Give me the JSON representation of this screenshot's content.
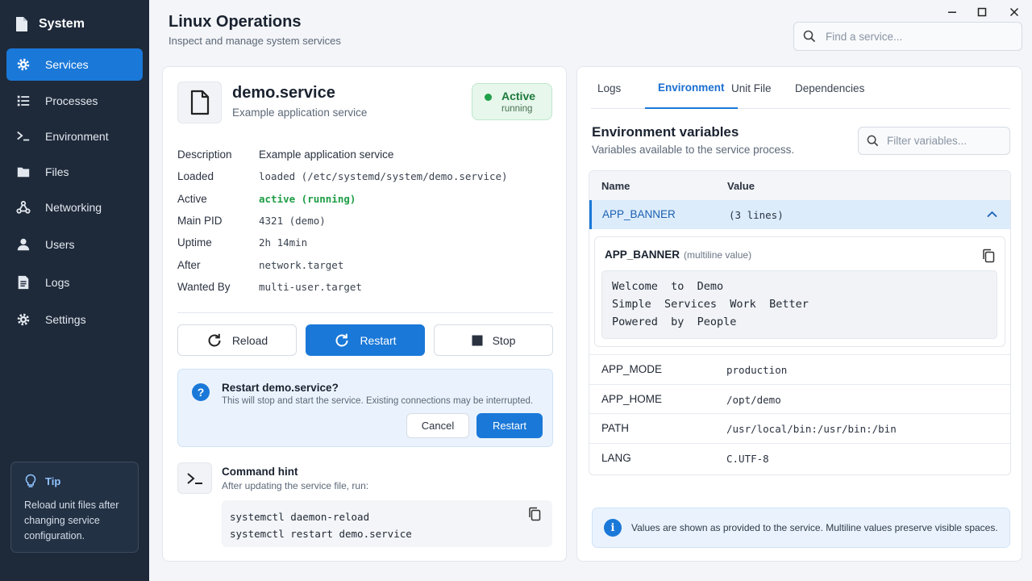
{
  "app": {
    "name": "System"
  },
  "sidebar": {
    "items": [
      {
        "label": "Services",
        "icon": "gear-icon",
        "active": true
      },
      {
        "label": "Processes",
        "icon": "list-icon"
      },
      {
        "label": "Environment",
        "icon": "terminal-icon"
      },
      {
        "label": "Files",
        "icon": "folder-icon"
      },
      {
        "label": "Networking",
        "icon": "network-icon"
      },
      {
        "label": "Users",
        "icon": "user-icon"
      },
      {
        "label": "Logs",
        "icon": "document-icon"
      },
      {
        "label": "Settings",
        "icon": "gear-icon"
      }
    ],
    "tip": {
      "title": "Tip",
      "text": "Reload unit files after changing service configuration."
    }
  },
  "header": {
    "title": "Linux Operations",
    "subtitle": "Inspect and manage system services",
    "search_placeholder": "Find a service..."
  },
  "service": {
    "name": "demo.service",
    "description": "Example application service",
    "status": {
      "label": "Active",
      "sub": "running"
    },
    "properties": [
      {
        "key": "Description",
        "value": "Example application service",
        "style": "plain"
      },
      {
        "key": "Loaded",
        "value": "loaded (/etc/systemd/system/demo.service)",
        "style": "mono"
      },
      {
        "key": "Active",
        "value": "active (running)",
        "style": "active"
      },
      {
        "key": "Main PID",
        "value": "4321 (demo)",
        "style": "mono"
      },
      {
        "key": "Uptime",
        "value": "2h 14min",
        "style": "mono"
      },
      {
        "key": "After",
        "value": "network.target",
        "style": "mono"
      },
      {
        "key": "Wanted By",
        "value": "multi-user.target",
        "style": "mono"
      }
    ],
    "actions": {
      "reload": "Reload",
      "restart": "Restart",
      "stop": "Stop"
    },
    "confirm": {
      "title": "Restart demo.service?",
      "text": "This will stop and start the service. Existing connections may be interrupted.",
      "cancel": "Cancel",
      "confirm": "Restart"
    },
    "hint": {
      "title": "Command hint",
      "subtitle": "After updating the service file, run:",
      "lines": [
        "systemctl daemon-reload",
        "systemctl restart demo.service"
      ]
    }
  },
  "tabs": [
    {
      "label": "Logs"
    },
    {
      "label": "Environment",
      "active": true
    },
    {
      "label": "Unit File"
    },
    {
      "label": "Dependencies"
    }
  ],
  "environment": {
    "title": "Environment variables",
    "subtitle": "Variables available to the service process.",
    "filter_placeholder": "Filter variables...",
    "columns": {
      "name": "Name",
      "value": "Value"
    },
    "expanded": {
      "name": "APP_BANNER",
      "summary": "(3 lines)",
      "note": "(multiline value)",
      "lines": [
        "Welcome  to  Demo",
        "Simple  Services  Work  Better",
        "Powered  by  People"
      ]
    },
    "rows": [
      {
        "name": "APP_MODE",
        "value": "production"
      },
      {
        "name": "APP_HOME",
        "value": "/opt/demo"
      },
      {
        "name": "PATH",
        "value": "/usr/local/bin:/usr/bin:/bin"
      },
      {
        "name": "LANG",
        "value": "C.UTF-8"
      }
    ],
    "info": "Values are shown as provided to the service. Multiline values preserve visible spaces."
  },
  "colors": {
    "accent": "#1a78d8",
    "sidebar": "#1e2a3a",
    "success": "#1f9d45"
  }
}
